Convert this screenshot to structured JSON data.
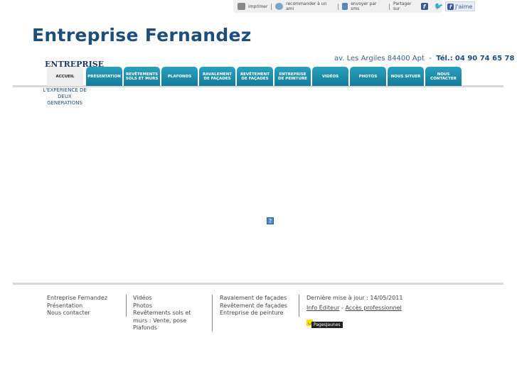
{
  "topbar": {
    "print": "imprimer",
    "recommend": "recommander à un ami",
    "sms": "envoyer par sms",
    "share": "Partager sur",
    "like": "J'aime",
    "fb_glyph": "f",
    "tw_glyph": "🐦"
  },
  "header": {
    "title": "Entreprise Fernandez",
    "address": "av. Les Argiles 84400 Apt",
    "phone_label": "Tél.:",
    "phone": "04 90 74 65 78",
    "logo_text": "ENTREPRISE",
    "slogan": "L'EXPERIENCE DE DEUX GENERATIONS"
  },
  "nav": [
    {
      "label": "ACCUEIL"
    },
    {
      "label": "PRÉSENTATION"
    },
    {
      "label": "REVÊTEMENTS SOLS ET MURS"
    },
    {
      "label": "PLAFONDS"
    },
    {
      "label": "RAVALEMENT DE FAÇADES"
    },
    {
      "label": "REVÊTEMENT DE FAÇADES"
    },
    {
      "label": "ENTREPRISE DE PEINTURE"
    },
    {
      "label": "VIDÉOS"
    },
    {
      "label": "PHOTOS"
    },
    {
      "label": "NOUS SITUER"
    },
    {
      "label": "NOUS CONTACTER"
    }
  ],
  "main": {
    "plugin_glyph": "?"
  },
  "footer": {
    "col1": [
      "Entreprise Fernandez",
      "Présentation",
      "Nous contacter"
    ],
    "col2": [
      "Vidéos",
      "Photos",
      "Revêtements sols et",
      "murs : Vente, pose",
      "Plafonds"
    ],
    "col3": [
      "Ravalement de façades",
      "Revêtement de façades",
      "Entreprise de peinture"
    ],
    "updated": "Dernière mise à jour : 14/05/2011",
    "info_editeur": "Info Éditeur",
    "dash": " - ",
    "acces_pro": "Accès professionnel",
    "pagesjaunes": "PagesJaunes"
  }
}
